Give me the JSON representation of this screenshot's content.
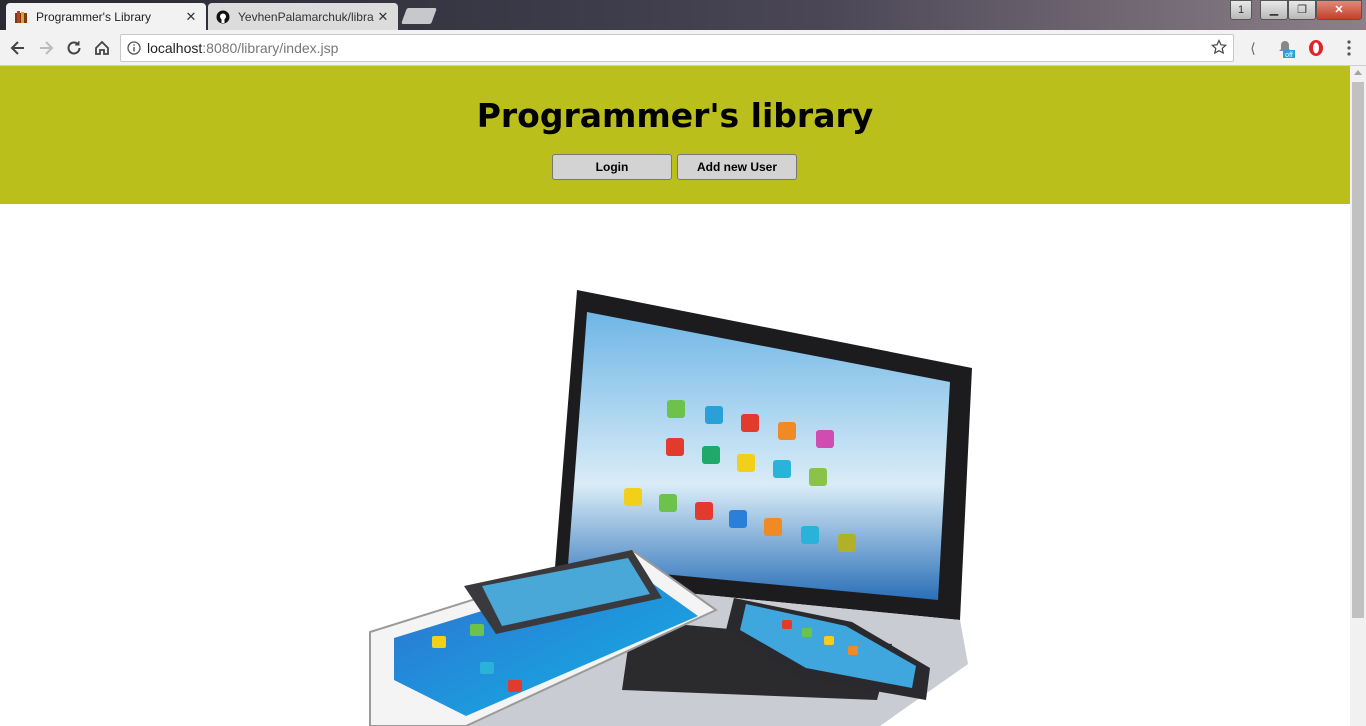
{
  "browser": {
    "tabs": [
      {
        "title": "Programmer's Library",
        "active": true
      },
      {
        "title": "YevhenPalamarchuk/libra",
        "active": false
      }
    ],
    "window_badge": "1",
    "address": {
      "host": "localhost",
      "path": ":8080/library/index.jsp"
    },
    "extension_badge": "off"
  },
  "page": {
    "title": "Programmer's library",
    "buttons": {
      "login": "Login",
      "add_user": "Add new User"
    },
    "header_color": "#bbbf1b"
  }
}
